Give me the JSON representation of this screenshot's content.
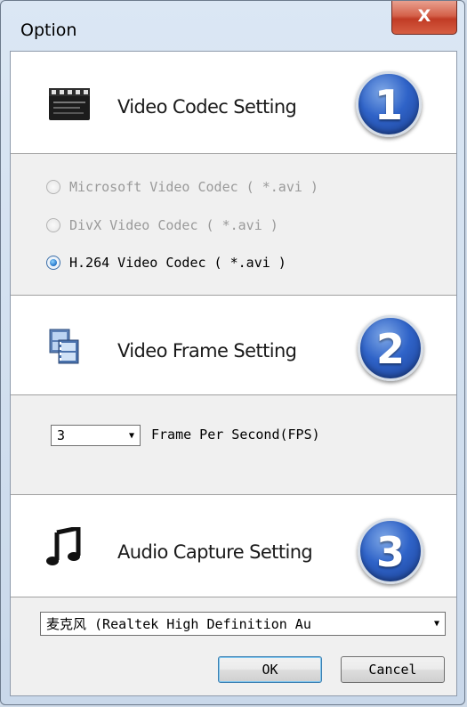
{
  "window": {
    "title": "Option"
  },
  "titlebar": {
    "close_glyph": "X"
  },
  "sections": [
    {
      "title": "Video Codec Setting",
      "number": "1",
      "icon": "clapperboard-icon"
    },
    {
      "title": "Video Frame Setting",
      "number": "2",
      "icon": "film-frames-icon"
    },
    {
      "title": "Audio Capture Setting",
      "number": "3",
      "icon": "music-note-icon"
    }
  ],
  "codec_options": [
    {
      "label": "Microsoft Video Codec ( *.avi )",
      "selected": false,
      "enabled": false
    },
    {
      "label": "DivX Video Codec ( *.avi )",
      "selected": false,
      "enabled": false
    },
    {
      "label": "H.264 Video Codec ( *.avi )",
      "selected": true,
      "enabled": true
    }
  ],
  "fps": {
    "value": "3",
    "label": "Frame Per Second(FPS)"
  },
  "audio": {
    "device": "麦克风 (Realtek High Definition Au"
  },
  "buttons": {
    "ok": "OK",
    "cancel": "Cancel"
  },
  "colors": {
    "badge_blue": "#2f63c8",
    "close_red": "#c13b25",
    "radio_selected": "#1f72c8"
  }
}
